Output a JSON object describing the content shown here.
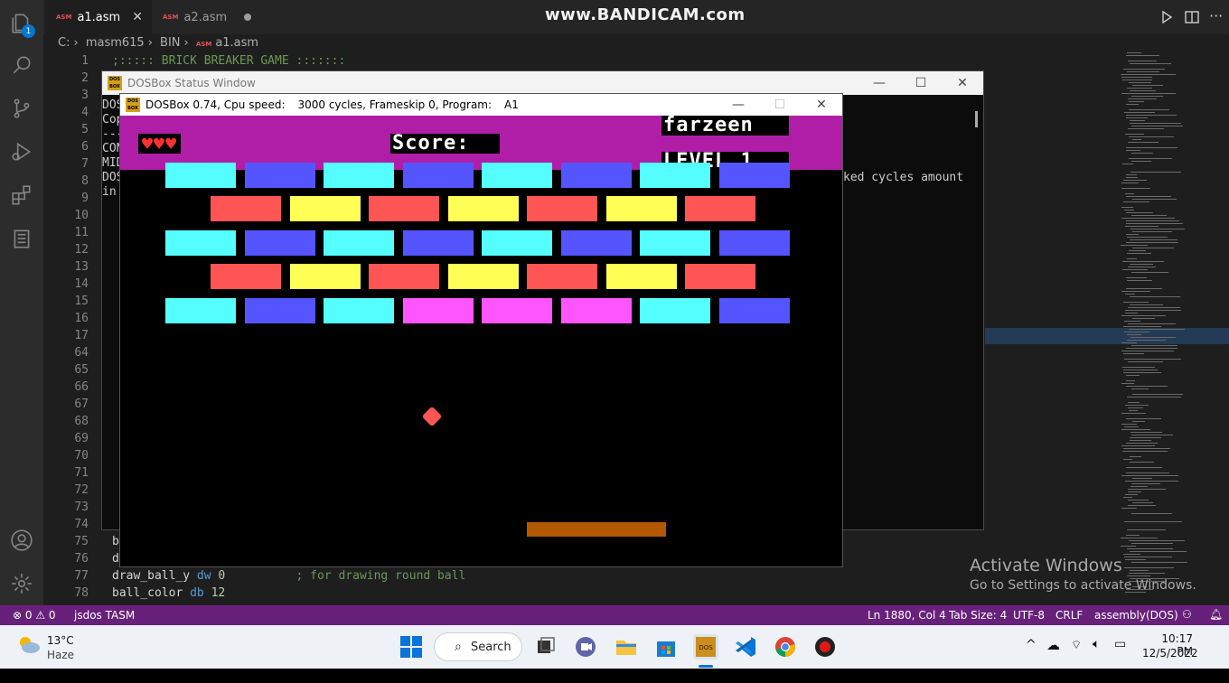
{
  "editor": {
    "tabs": [
      {
        "label": "a1.asm",
        "icon": "asm-file-icon",
        "active": true
      },
      {
        "label": "a2.asm",
        "icon": "asm-file-icon",
        "active": false
      }
    ],
    "watermark": "www.BANDICAM.com",
    "breadcrumb": [
      "C:",
      "masm615",
      "BIN",
      "a1.asm"
    ],
    "explorer_badge": "1",
    "lines": [
      {
        "n": "1",
        "text": ";::::: BRICK BREAKER GAME :::::::"
      },
      {
        "n": "2",
        "text": ""
      },
      {
        "n": "3",
        "text": ""
      },
      {
        "n": "4",
        "text": ""
      },
      {
        "n": "5",
        "text": ""
      },
      {
        "n": "6",
        "text": ""
      },
      {
        "n": "7",
        "text": ""
      },
      {
        "n": "8",
        "text": ""
      },
      {
        "n": "9",
        "text": ""
      },
      {
        "n": "10",
        "text": ""
      },
      {
        "n": "11",
        "text": ""
      },
      {
        "n": "12",
        "text": ""
      },
      {
        "n": "13",
        "text": ""
      },
      {
        "n": "14",
        "text": ""
      },
      {
        "n": "15",
        "text": ""
      },
      {
        "n": "16",
        "text": ""
      },
      {
        "n": "17",
        "text": ""
      },
      {
        "n": "64",
        "text": ""
      },
      {
        "n": "65",
        "text": ""
      },
      {
        "n": "66",
        "text": ""
      },
      {
        "n": "67",
        "text": ""
      },
      {
        "n": "68",
        "text": ""
      },
      {
        "n": "69",
        "text": ""
      },
      {
        "n": "70",
        "text": ""
      },
      {
        "n": "71",
        "text": ""
      },
      {
        "n": "72",
        "text": ""
      },
      {
        "n": "73",
        "text": ""
      },
      {
        "n": "74",
        "text": ""
      },
      {
        "n": "75",
        "text": "b"
      },
      {
        "n": "76",
        "text": "d"
      }
    ],
    "line77": {
      "n": "77",
      "name": "draw_ball_y",
      "kw": "dw",
      "val": "0",
      "comment": "; for drawing round ball"
    },
    "line78": {
      "n": "78",
      "name": "ball_color",
      "kw": "db",
      "val": "12"
    }
  },
  "status_window": {
    "title": "DOSBox Status Window",
    "left_fragments": [
      "DOS",
      "Cop",
      "---",
      "CON",
      "MID",
      "DOS",
      "in"
    ],
    "right_fragment": "ked cycles amount"
  },
  "dosbox": {
    "title_app": "DOSBox 0.74, Cpu speed:",
    "cycles": "3000 cycles, Frameskip  0, Program:",
    "program": "A1",
    "hearts": "♥♥♥",
    "score_label": "Score:",
    "player": "farzeen",
    "level": "LEVEL 1",
    "colors": {
      "hud": "#b01ea8",
      "cyan": "#55ffff",
      "blue": "#5555ff",
      "red": "#ff5555",
      "yellow": "#ffff55",
      "pink": "#ff55ff",
      "paddle": "#b35800"
    },
    "bricks": [
      [
        "cyan",
        "blue",
        "cyan",
        "blue",
        "cyan",
        "blue",
        "cyan",
        "blue"
      ],
      [
        "red",
        "yellow",
        "red",
        "yellow",
        "red",
        "yellow",
        "red"
      ],
      [
        "cyan",
        "blue",
        "cyan",
        "blue",
        "cyan",
        "blue",
        "cyan",
        "blue"
      ],
      [
        "red",
        "yellow",
        "red",
        "yellow",
        "red",
        "yellow",
        "red"
      ],
      [
        "cyan",
        "blue",
        "cyan",
        "pink",
        "pink",
        "pink",
        "cyan",
        "blue"
      ]
    ]
  },
  "activate": {
    "line1": "Activate Windows",
    "line2": "Go to Settings to activate Windows."
  },
  "statusbar": {
    "problems": "⊗ 0 ⚠ 0",
    "jsdos": "jsdos TASM",
    "position": "Ln 1880, Col 4",
    "tabsize": "Tab Size: 4",
    "encoding": "UTF-8",
    "eol": "CRLF",
    "language": "assembly(DOS)"
  },
  "taskbar": {
    "weather_temp": "13°C",
    "weather_desc": "Haze",
    "search": "Search",
    "time": "10:17 PM",
    "date": "12/5/2022"
  }
}
